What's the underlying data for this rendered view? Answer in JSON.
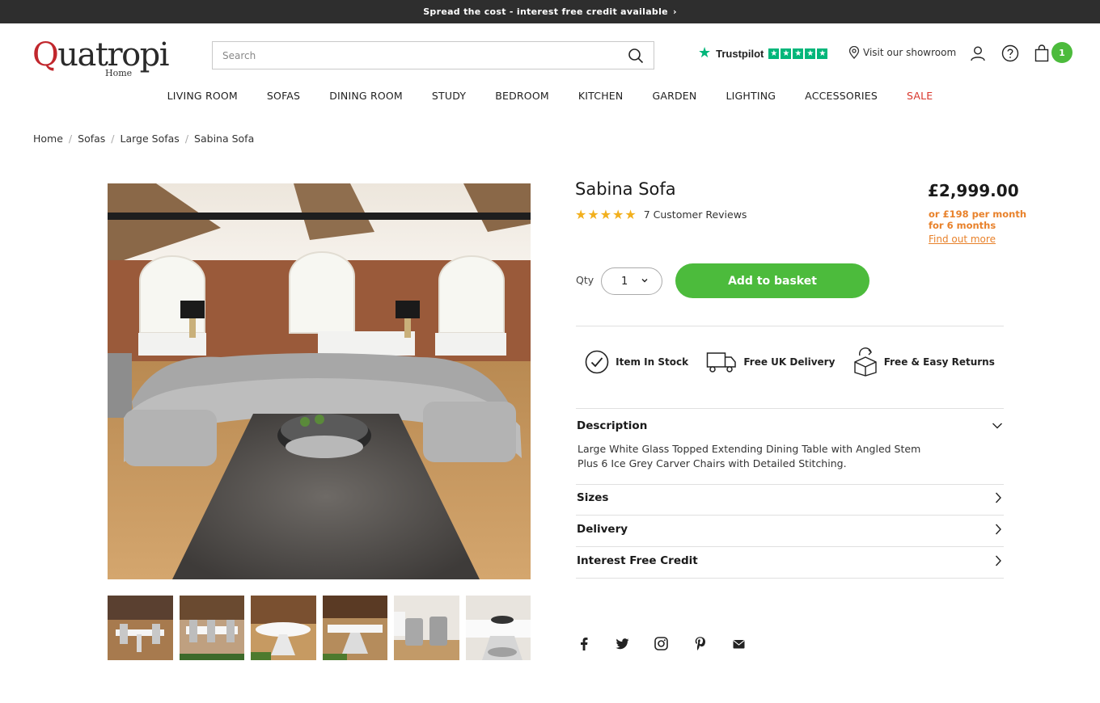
{
  "topbar": {
    "text": "Spread the cost - interest free credit available",
    "chevron": "›"
  },
  "logo": {
    "word_first": "Q",
    "word_rest": "uatropi",
    "sub": "Home"
  },
  "search": {
    "placeholder": "Search",
    "icon": "search-icon"
  },
  "trustpilot": {
    "label": "Trustpilot",
    "stars": 5
  },
  "showroom": {
    "label": "Visit our showroom",
    "icon": "map-pin-icon"
  },
  "header_icons": {
    "account": "user-icon",
    "help": "help-icon",
    "basket": "basket-icon"
  },
  "cart": {
    "count": "1"
  },
  "nav": [
    {
      "label": "LIVING ROOM"
    },
    {
      "label": "SOFAS"
    },
    {
      "label": "DINING ROOM"
    },
    {
      "label": "STUDY"
    },
    {
      "label": "BEDROOM"
    },
    {
      "label": "KITCHEN"
    },
    {
      "label": "GARDEN"
    },
    {
      "label": "LIGHTING"
    },
    {
      "label": "ACCESSORIES"
    },
    {
      "label": "SALE"
    }
  ],
  "breadcrumb": [
    "Home",
    "Sofas",
    "Large Sofas",
    "Sabina Sofa"
  ],
  "breadcrumb_sep": "/",
  "product": {
    "title": "Sabina Sofa",
    "stars": "★★★★★",
    "reviews": "7 Customer Reviews",
    "price": "£2,999.00",
    "credit": "or £198 per month for 6 months",
    "find_out": "Find out more",
    "qty_label": "Qty",
    "qty_value": "1",
    "add_to_basket": "Add to basket"
  },
  "usps": [
    {
      "label": "Item In Stock",
      "icon": "check-circle-icon"
    },
    {
      "label": "Free UK Delivery",
      "icon": "truck-icon"
    },
    {
      "label": "Free & Easy Returns",
      "icon": "return-box-icon"
    }
  ],
  "accordion": {
    "description": {
      "title": "Description",
      "text": "Large White Glass Topped Extending Dining Table with Angled Stem Plus 6 Ice Grey Carver Chairs with Detailed Stitching."
    },
    "sizes": {
      "title": "Sizes"
    },
    "delivery": {
      "title": "Delivery"
    },
    "credit": {
      "title": "Interest Free Credit"
    }
  },
  "social": [
    "facebook-icon",
    "twitter-icon",
    "instagram-icon",
    "pinterest-icon",
    "email-icon"
  ],
  "colors": {
    "accent_green": "#4cbb3c",
    "credit_orange": "#e8812a",
    "sale_red": "#d9362b",
    "topbar": "#2e2e2e",
    "trustpilot_green": "#00b67a",
    "star_gold": "#f2b01e"
  }
}
